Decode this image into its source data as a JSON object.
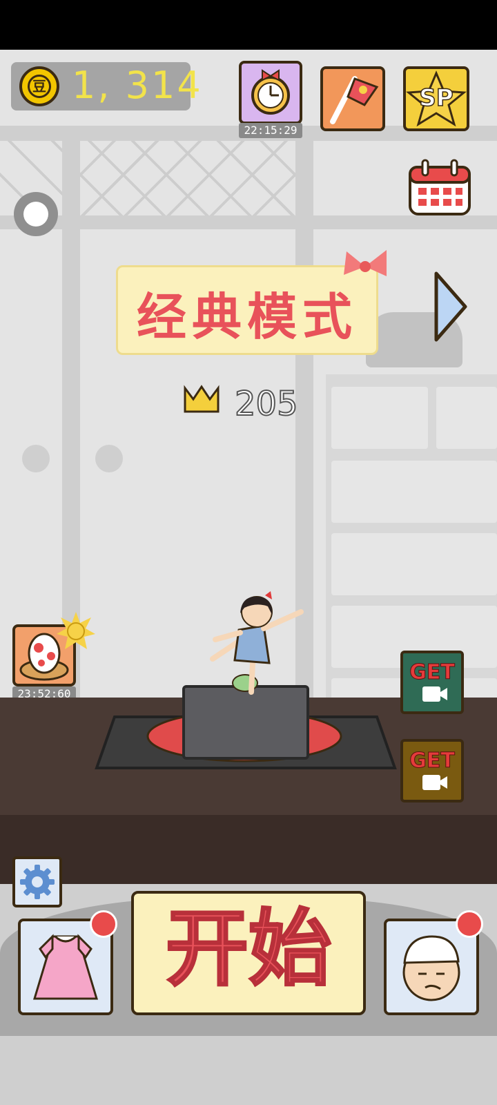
{
  "coins": {
    "amount": "1, 314",
    "symbol": "豆"
  },
  "topbar": {
    "alarm_timer": "22:15:29",
    "sp_label": "SP"
  },
  "mode": {
    "title": "经典模式",
    "best_score": "205"
  },
  "egg_timer": "23:52:60",
  "get_buttons": {
    "get1": "GET",
    "get2": "GET"
  },
  "start_button": {
    "label": "开始"
  },
  "colors": {
    "accent": "#e8525a",
    "cream": "#fbf1bd",
    "outline": "#3b2a12"
  }
}
